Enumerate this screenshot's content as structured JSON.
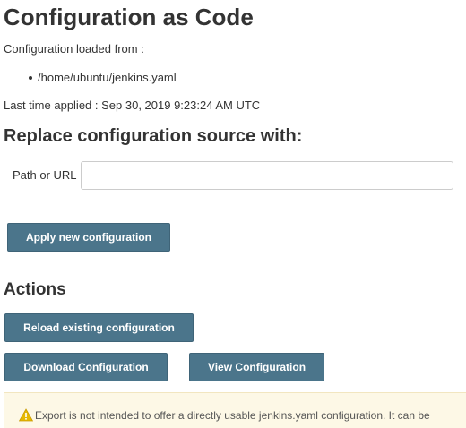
{
  "header": {
    "title": "Configuration as Code"
  },
  "config": {
    "loaded_from_label": "Configuration loaded from :",
    "sources": [
      "/home/ubuntu/jenkins.yaml"
    ],
    "last_applied": "Last time applied : Sep 30, 2019 9:23:24 AM UTC"
  },
  "replace": {
    "title": "Replace configuration source with:",
    "path_label": "Path or URL",
    "path_value": "",
    "apply_button": "Apply new configuration"
  },
  "actions": {
    "title": "Actions",
    "reload_button": "Reload existing configuration",
    "download_button": "Download Configuration",
    "view_button": "View Configuration"
  },
  "warning": {
    "icon": "warning-icon",
    "text": "Export is not intended to offer a directly usable jenkins.yaml configuration. It can be",
    "colors": {
      "background": "#fdf8e6",
      "icon": "#e6b800"
    }
  },
  "colors": {
    "button": "#4b758b",
    "text": "#333333"
  }
}
